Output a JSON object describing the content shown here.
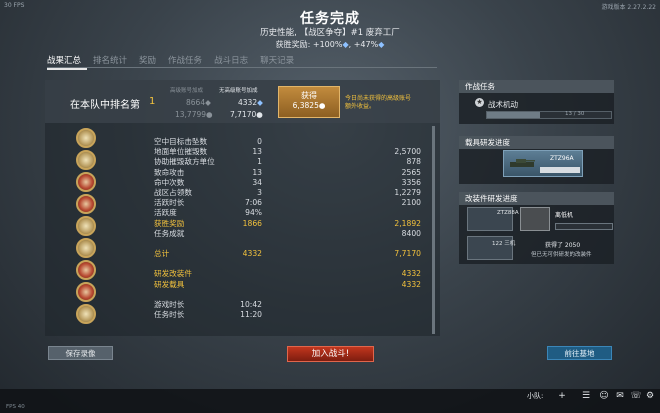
{
  "hud": {
    "fps_top": "30 FPS",
    "version": "游戏版本 2.27.2.22",
    "fps_bottom": "FPS 40"
  },
  "header": {
    "title": "任务完成",
    "subtitle": "历史性能, 【战区争夺】#1 废弃工厂",
    "bonus_label": "获胜奖励:",
    "bonus_xp": "+100%",
    "bonus_sl": "+47%"
  },
  "tabs": [
    "战果汇总",
    "排名统计",
    "奖励",
    "作战任务",
    "战斗日志",
    "聊天记录"
  ],
  "rank": {
    "label": "在本队中排名第",
    "position": "1",
    "col_no_account": "高级账号加成",
    "col_account": "无高级账号加成",
    "row1_no": "8664",
    "row1_yes": "4332",
    "row2_no": "13,7799",
    "row2_yes": "7,7170"
  },
  "obtain": {
    "label": "获得",
    "value": "6,3825",
    "note": "今日尚未获得的高级账号额外收益。"
  },
  "stats": [
    {
      "name": "空中目标击坠数",
      "value": "0",
      "xp": ""
    },
    {
      "name": "地面单位摧毁数",
      "value": "13",
      "xp": "2,5700"
    },
    {
      "name": "协助摧毁敌方单位",
      "value": "1",
      "xp": "878"
    },
    {
      "name": "致命攻击",
      "value": "13",
      "xp": "2565"
    },
    {
      "name": "命中次数",
      "value": "34",
      "xp": "3356"
    },
    {
      "name": "战区占领数",
      "value": "3",
      "xp": "1,2279"
    },
    {
      "name": "活跃时长",
      "value": "7:06",
      "xp": "2100"
    },
    {
      "name": "活跃度",
      "value": "94%",
      "xp": ""
    },
    {
      "name": "获胜奖励",
      "value": "1866",
      "xp": "2,1892",
      "highlight": true
    },
    {
      "name": "任务成就",
      "value": "",
      "xp": "8400"
    },
    {
      "name": "",
      "value": "",
      "xp": ""
    },
    {
      "name": "总计",
      "value": "4332",
      "xp": "7,7170",
      "highlight": true
    },
    {
      "name": "",
      "value": "",
      "xp": ""
    },
    {
      "name": "研发改装件",
      "value": "",
      "xp": "4332",
      "highlight": true
    },
    {
      "name": "研发载具",
      "value": "",
      "xp": "4332",
      "highlight": true
    },
    {
      "name": "",
      "value": "",
      "xp": ""
    },
    {
      "name": "游戏时长",
      "value": "10:42",
      "xp": ""
    },
    {
      "name": "任务时长",
      "value": "11:20",
      "xp": ""
    }
  ],
  "buttons": {
    "save_replay": "保存录像",
    "join_battle": "加入战斗!",
    "to_base": "前往基地"
  },
  "mission_panel": {
    "title": "作战任务",
    "mission": "战术机动",
    "progress": "13 / 30",
    "progress_fraction": 0.43
  },
  "vehicle_panel": {
    "title": "载具研发进度",
    "vehicle": "ZTZ96A",
    "progress_fraction": 1.0
  },
  "mods_panel": {
    "title": "改装件研发进度",
    "mod1": "ZTZ88A",
    "mod2": "离低机",
    "mod3": "122 三机",
    "gained": "获得了 2050",
    "note": "但已无可供研发的改装件"
  },
  "bottom": {
    "squad": "小队:"
  }
}
